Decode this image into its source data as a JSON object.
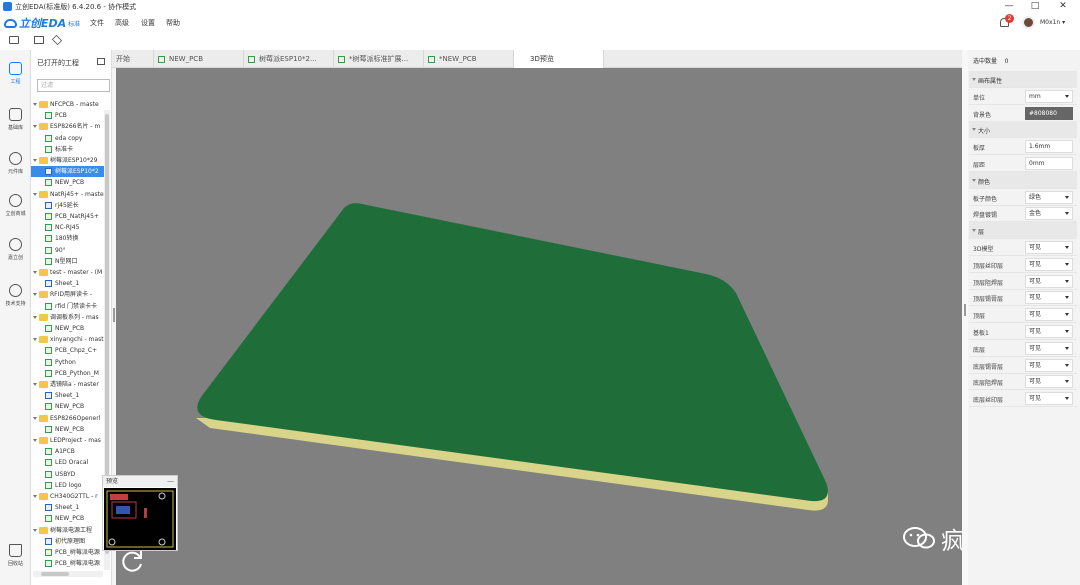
{
  "window": {
    "title": "立创EDA(标准版) 6.4.20.6 - 协作模式",
    "min_label": "—",
    "max_label": "□",
    "close_label": "✕"
  },
  "menu": {
    "brand": "立创EDA",
    "edition": "标准",
    "items": [
      "文件",
      "高级",
      "设置",
      "帮助"
    ]
  },
  "user": {
    "notifications": "2",
    "name": "M0x1n",
    "chevron": "▾"
  },
  "toolbar": {
    "icons": [
      "folder-open-icon",
      "save-icon",
      "layers-icon"
    ]
  },
  "left_nav": [
    {
      "label": "工程",
      "icon": "project-icon"
    },
    {
      "label": "基础库",
      "icon": "library-icon"
    },
    {
      "label": "元件库",
      "icon": "search-component-icon"
    },
    {
      "label": "立创商城",
      "icon": "lcsc-mall-icon"
    },
    {
      "label": "嘉立创",
      "icon": "jlc-icon"
    },
    {
      "label": "技术支持",
      "icon": "help-icon"
    },
    {
      "label": "回收站",
      "icon": "trash-icon"
    }
  ],
  "project_panel": {
    "title": "已打开的工程",
    "filter_placeholder": "过滤",
    "tree": [
      {
        "type": "folder",
        "label": "NFCPCB - maste",
        "level": 0
      },
      {
        "type": "pcb",
        "label": "PCB",
        "level": 1
      },
      {
        "type": "folder",
        "label": "ESP8266名片 - m",
        "level": 0
      },
      {
        "type": "pcb",
        "label": "eda copy",
        "level": 1
      },
      {
        "type": "pcb",
        "label": "标准卡",
        "level": 1
      },
      {
        "type": "folder",
        "label": "树莓派ESP10*29",
        "level": 0
      },
      {
        "type": "sch",
        "label": "树莓派ESP10*2",
        "level": 1,
        "selected": true
      },
      {
        "type": "pcb",
        "label": "NEW_PCB",
        "level": 1
      },
      {
        "type": "folder",
        "label": "NatRj45+ - maste",
        "level": 0
      },
      {
        "type": "sch",
        "label": "rj45延长",
        "level": 1
      },
      {
        "type": "pcb",
        "label": "PCB_NatRj45+",
        "level": 1
      },
      {
        "type": "pcb",
        "label": "NC-RJ45",
        "level": 1
      },
      {
        "type": "pcb",
        "label": "180转换",
        "level": 1
      },
      {
        "type": "pcb",
        "label": "90°",
        "level": 1
      },
      {
        "type": "pcb",
        "label": "N型网口",
        "level": 1
      },
      {
        "type": "folder",
        "label": "test - master - (M",
        "level": 0
      },
      {
        "type": "sch",
        "label": "Sheet_1",
        "level": 1
      },
      {
        "type": "folder",
        "label": "RFID用屏读卡 -",
        "level": 0
      },
      {
        "type": "pcb",
        "label": "rfid 门禁读卡卡",
        "level": 1
      },
      {
        "type": "folder",
        "label": "调调板系列 - mas",
        "level": 0
      },
      {
        "type": "pcb",
        "label": "NEW_PCB",
        "level": 1
      },
      {
        "type": "folder",
        "label": "xinyangchi - mast",
        "level": 0
      },
      {
        "type": "pcb",
        "label": "PCB_Chpz_C+",
        "level": 1
      },
      {
        "type": "pcb",
        "label": "Python",
        "level": 1
      },
      {
        "type": "pcb",
        "label": "PCB_Python_M",
        "level": 1
      },
      {
        "type": "folder",
        "label": "透镜陪a - master",
        "level": 0
      },
      {
        "type": "sch",
        "label": "Sheet_1",
        "level": 1
      },
      {
        "type": "pcb",
        "label": "NEW_PCB",
        "level": 1
      },
      {
        "type": "folder",
        "label": "ESP8266Openerl",
        "level": 0
      },
      {
        "type": "pcb",
        "label": "NEW_PCB",
        "level": 1
      },
      {
        "type": "folder",
        "label": "LEDProject - mas",
        "level": 0
      },
      {
        "type": "pcb",
        "label": "A1PCB",
        "level": 1
      },
      {
        "type": "pcb",
        "label": "LED Oracal",
        "level": 1
      },
      {
        "type": "pcb",
        "label": "USBYD",
        "level": 1
      },
      {
        "type": "pcb",
        "label": "LED logo",
        "level": 1
      },
      {
        "type": "folder",
        "label": "CH340G2TTL - r",
        "level": 0
      },
      {
        "type": "sch",
        "label": "Sheet_1",
        "level": 1
      },
      {
        "type": "pcb",
        "label": "NEW_PCB",
        "level": 1
      },
      {
        "type": "folder",
        "label": "树莓派电源工程",
        "level": 0
      },
      {
        "type": "sch",
        "label": "初代原理图",
        "level": 1
      },
      {
        "type": "pcb",
        "label": "PCB_树莓派电源",
        "level": 1
      },
      {
        "type": "pcb",
        "label": "PCB_树莓派电源",
        "level": 1
      }
    ]
  },
  "tabs": [
    {
      "label": "开始",
      "active": false,
      "icon": false
    },
    {
      "label": "NEW_PCB",
      "active": false,
      "icon": true
    },
    {
      "label": "树莓派ESP10*2...",
      "active": false,
      "icon": true
    },
    {
      "label": "*树莓派标准扩展...",
      "active": false,
      "icon": true
    },
    {
      "label": "*NEW_PCB",
      "active": false,
      "icon": true
    },
    {
      "label": "3D预览",
      "active": true,
      "icon": false
    }
  ],
  "preview": {
    "title": "预览",
    "close": "—"
  },
  "watermark": {
    "text": "疯猫网络"
  },
  "properties": {
    "selected_count_label": "选中数量",
    "selected_count": "0",
    "rows": [
      {
        "kind": "section",
        "label": "画布属性"
      },
      {
        "kind": "field",
        "label": "单位",
        "value": "mm",
        "dropdown": true
      },
      {
        "kind": "field",
        "label": "背景色",
        "value": "#808080",
        "dark": true
      },
      {
        "kind": "section",
        "label": "大小"
      },
      {
        "kind": "field",
        "label": "板厚",
        "value": "1.6mm"
      },
      {
        "kind": "field",
        "label": "层距",
        "value": "0mm"
      },
      {
        "kind": "section",
        "label": "颜色"
      },
      {
        "kind": "field",
        "label": "板子颜色",
        "value": "绿色",
        "dropdown": true
      },
      {
        "kind": "field",
        "label": "焊盘镀锡",
        "value": "金色",
        "dropdown": true
      },
      {
        "kind": "section",
        "label": "层"
      },
      {
        "kind": "field",
        "label": "3D模型",
        "value": "可见",
        "dropdown": true
      },
      {
        "kind": "field",
        "label": "顶层丝印层",
        "value": "可见",
        "dropdown": true
      },
      {
        "kind": "field",
        "label": "顶层阻焊层",
        "value": "可见",
        "dropdown": true
      },
      {
        "kind": "field",
        "label": "顶层锡膏层",
        "value": "可见",
        "dropdown": true
      },
      {
        "kind": "field",
        "label": "顶层",
        "value": "可见",
        "dropdown": true
      },
      {
        "kind": "field",
        "label": "基板1",
        "value": "可见",
        "dropdown": true
      },
      {
        "kind": "field",
        "label": "底层",
        "value": "可见",
        "dropdown": true
      },
      {
        "kind": "field",
        "label": "底层锡膏层",
        "value": "可见",
        "dropdown": true
      },
      {
        "kind": "field",
        "label": "底层阻焊层",
        "value": "可见",
        "dropdown": true
      },
      {
        "kind": "field",
        "label": "底层丝印层",
        "value": "可见",
        "dropdown": true
      }
    ]
  },
  "colors": {
    "board_green": "#1f6e3a",
    "board_edge": "#d8d58a",
    "viewport_bg": "#808080",
    "accent": "#1f7ae0"
  }
}
